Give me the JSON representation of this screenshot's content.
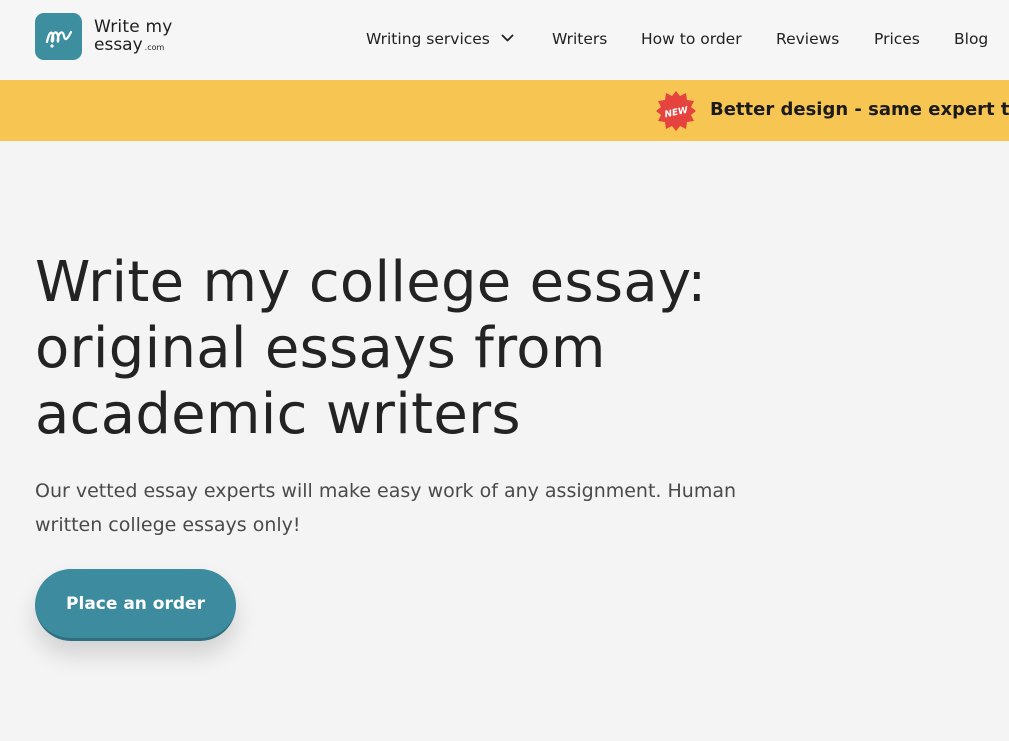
{
  "header": {
    "logo": {
      "line1": "Write my",
      "line2": "essay",
      "suffix": ".com",
      "icon": "pen-scribble-icon",
      "brand_color": "#3d8fa0"
    },
    "nav": [
      {
        "label": "Writing services",
        "has_dropdown": true
      },
      {
        "label": "Writers"
      },
      {
        "label": "How to order"
      },
      {
        "label": "Reviews"
      },
      {
        "label": "Prices"
      },
      {
        "label": "Blog"
      }
    ]
  },
  "banner": {
    "badge": "NEW",
    "text": "Better design - same expert tea",
    "background": "#f7c552",
    "badge_color": "#e5443e"
  },
  "hero": {
    "title_lines": [
      "Write my college essay:",
      "original essays from",
      "academic writers"
    ],
    "subtitle_lines": [
      "Our vetted essay experts will make easy work of any assignment. Human",
      "written college essays only!"
    ],
    "cta_label": "Place an order",
    "cta_color": "#3d8b9e"
  }
}
